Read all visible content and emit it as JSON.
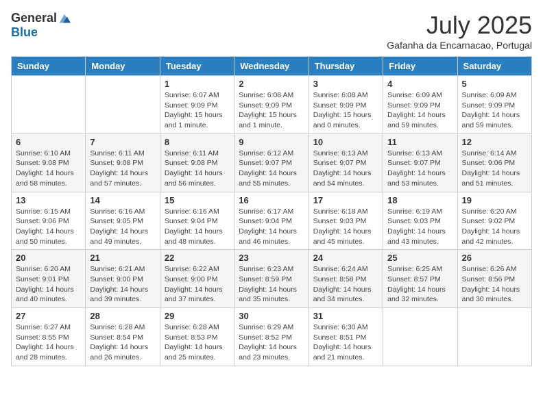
{
  "header": {
    "logo_general": "General",
    "logo_blue": "Blue",
    "month_title": "July 2025",
    "subtitle": "Gafanha da Encarnacao, Portugal"
  },
  "days_of_week": [
    "Sunday",
    "Monday",
    "Tuesday",
    "Wednesday",
    "Thursday",
    "Friday",
    "Saturday"
  ],
  "weeks": [
    [
      {
        "day": "",
        "info": ""
      },
      {
        "day": "",
        "info": ""
      },
      {
        "day": "1",
        "info": "Sunrise: 6:07 AM\nSunset: 9:09 PM\nDaylight: 15 hours and 1 minute."
      },
      {
        "day": "2",
        "info": "Sunrise: 6:08 AM\nSunset: 9:09 PM\nDaylight: 15 hours and 1 minute."
      },
      {
        "day": "3",
        "info": "Sunrise: 6:08 AM\nSunset: 9:09 PM\nDaylight: 15 hours and 0 minutes."
      },
      {
        "day": "4",
        "info": "Sunrise: 6:09 AM\nSunset: 9:09 PM\nDaylight: 14 hours and 59 minutes."
      },
      {
        "day": "5",
        "info": "Sunrise: 6:09 AM\nSunset: 9:09 PM\nDaylight: 14 hours and 59 minutes."
      }
    ],
    [
      {
        "day": "6",
        "info": "Sunrise: 6:10 AM\nSunset: 9:08 PM\nDaylight: 14 hours and 58 minutes."
      },
      {
        "day": "7",
        "info": "Sunrise: 6:11 AM\nSunset: 9:08 PM\nDaylight: 14 hours and 57 minutes."
      },
      {
        "day": "8",
        "info": "Sunrise: 6:11 AM\nSunset: 9:08 PM\nDaylight: 14 hours and 56 minutes."
      },
      {
        "day": "9",
        "info": "Sunrise: 6:12 AM\nSunset: 9:07 PM\nDaylight: 14 hours and 55 minutes."
      },
      {
        "day": "10",
        "info": "Sunrise: 6:13 AM\nSunset: 9:07 PM\nDaylight: 14 hours and 54 minutes."
      },
      {
        "day": "11",
        "info": "Sunrise: 6:13 AM\nSunset: 9:07 PM\nDaylight: 14 hours and 53 minutes."
      },
      {
        "day": "12",
        "info": "Sunrise: 6:14 AM\nSunset: 9:06 PM\nDaylight: 14 hours and 51 minutes."
      }
    ],
    [
      {
        "day": "13",
        "info": "Sunrise: 6:15 AM\nSunset: 9:06 PM\nDaylight: 14 hours and 50 minutes."
      },
      {
        "day": "14",
        "info": "Sunrise: 6:16 AM\nSunset: 9:05 PM\nDaylight: 14 hours and 49 minutes."
      },
      {
        "day": "15",
        "info": "Sunrise: 6:16 AM\nSunset: 9:04 PM\nDaylight: 14 hours and 48 minutes."
      },
      {
        "day": "16",
        "info": "Sunrise: 6:17 AM\nSunset: 9:04 PM\nDaylight: 14 hours and 46 minutes."
      },
      {
        "day": "17",
        "info": "Sunrise: 6:18 AM\nSunset: 9:03 PM\nDaylight: 14 hours and 45 minutes."
      },
      {
        "day": "18",
        "info": "Sunrise: 6:19 AM\nSunset: 9:03 PM\nDaylight: 14 hours and 43 minutes."
      },
      {
        "day": "19",
        "info": "Sunrise: 6:20 AM\nSunset: 9:02 PM\nDaylight: 14 hours and 42 minutes."
      }
    ],
    [
      {
        "day": "20",
        "info": "Sunrise: 6:20 AM\nSunset: 9:01 PM\nDaylight: 14 hours and 40 minutes."
      },
      {
        "day": "21",
        "info": "Sunrise: 6:21 AM\nSunset: 9:00 PM\nDaylight: 14 hours and 39 minutes."
      },
      {
        "day": "22",
        "info": "Sunrise: 6:22 AM\nSunset: 9:00 PM\nDaylight: 14 hours and 37 minutes."
      },
      {
        "day": "23",
        "info": "Sunrise: 6:23 AM\nSunset: 8:59 PM\nDaylight: 14 hours and 35 minutes."
      },
      {
        "day": "24",
        "info": "Sunrise: 6:24 AM\nSunset: 8:58 PM\nDaylight: 14 hours and 34 minutes."
      },
      {
        "day": "25",
        "info": "Sunrise: 6:25 AM\nSunset: 8:57 PM\nDaylight: 14 hours and 32 minutes."
      },
      {
        "day": "26",
        "info": "Sunrise: 6:26 AM\nSunset: 8:56 PM\nDaylight: 14 hours and 30 minutes."
      }
    ],
    [
      {
        "day": "27",
        "info": "Sunrise: 6:27 AM\nSunset: 8:55 PM\nDaylight: 14 hours and 28 minutes."
      },
      {
        "day": "28",
        "info": "Sunrise: 6:28 AM\nSunset: 8:54 PM\nDaylight: 14 hours and 26 minutes."
      },
      {
        "day": "29",
        "info": "Sunrise: 6:28 AM\nSunset: 8:53 PM\nDaylight: 14 hours and 25 minutes."
      },
      {
        "day": "30",
        "info": "Sunrise: 6:29 AM\nSunset: 8:52 PM\nDaylight: 14 hours and 23 minutes."
      },
      {
        "day": "31",
        "info": "Sunrise: 6:30 AM\nSunset: 8:51 PM\nDaylight: 14 hours and 21 minutes."
      },
      {
        "day": "",
        "info": ""
      },
      {
        "day": "",
        "info": ""
      }
    ]
  ]
}
